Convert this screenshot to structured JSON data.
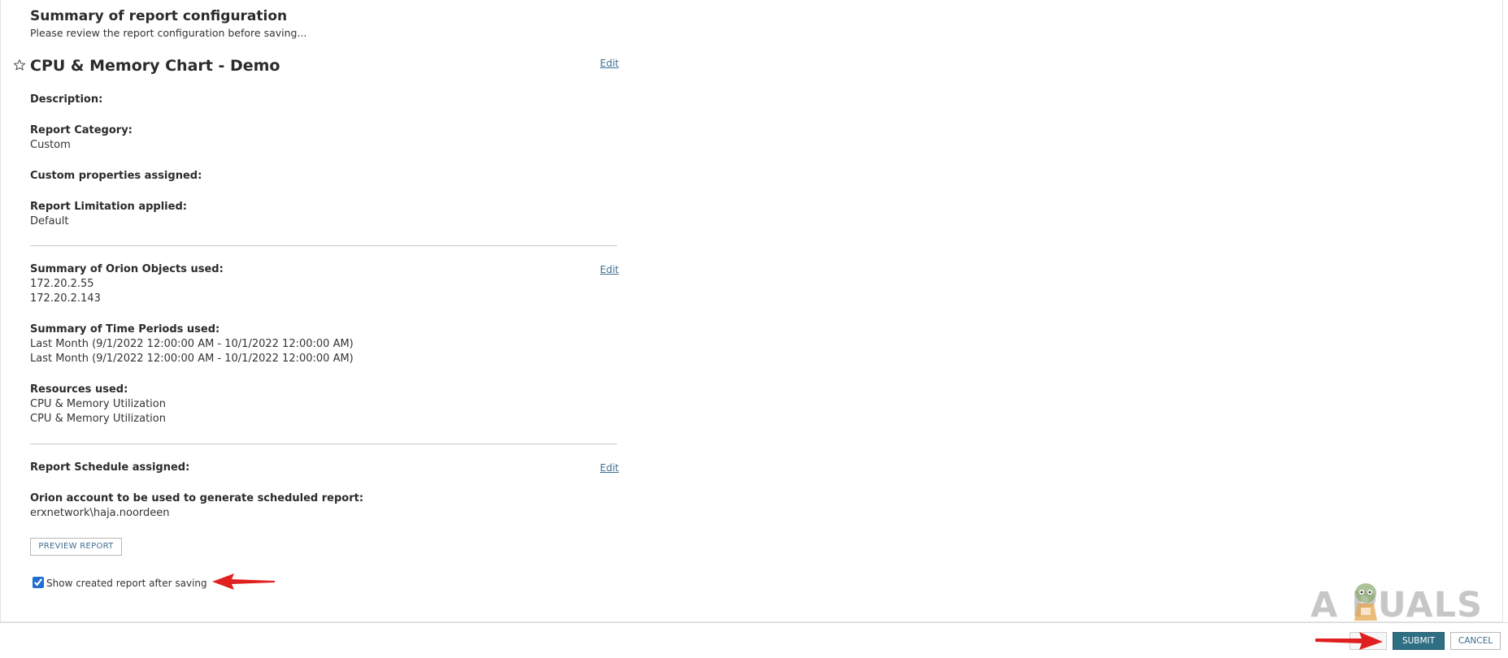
{
  "header": {
    "title": "Summary of report configuration",
    "subtitle": "Please review the report configuration before saving..."
  },
  "report": {
    "name": "CPU & Memory Chart - Demo",
    "edit_label": "Edit",
    "favorite_icon": "star-outline-icon"
  },
  "details": {
    "description_label": "Description:",
    "category_label": "Report Category:",
    "category_value": "Custom",
    "custom_props_label": "Custom properties assigned:",
    "limitation_label": "Report Limitation applied:",
    "limitation_value": "Default"
  },
  "objects": {
    "label": "Summary of Orion Objects used:",
    "edit_label": "Edit",
    "items": [
      "172.20.2.55",
      "172.20.2.143"
    ]
  },
  "time_periods": {
    "label": "Summary of Time Periods used:",
    "items": [
      "Last Month (9/1/2022 12:00:00 AM - 10/1/2022 12:00:00 AM)",
      "Last Month (9/1/2022 12:00:00 AM - 10/1/2022 12:00:00 AM)"
    ]
  },
  "resources": {
    "label": "Resources used:",
    "items": [
      "CPU & Memory Utilization",
      "CPU & Memory Utilization"
    ]
  },
  "schedule": {
    "label": "Report Schedule assigned:",
    "edit_label": "Edit",
    "account_label": "Orion account to be used to generate scheduled report:",
    "account_value": "erxnetwork\\haja.noordeen"
  },
  "actions": {
    "preview_label": "PREVIEW REPORT",
    "show_after_save_label": "Show created report after saving",
    "show_after_save_checked": true,
    "submit_label": "SUBMIT",
    "cancel_label": "CANCEL"
  },
  "colors": {
    "link": "#3e6f93",
    "submit_bg": "#2f6f83",
    "annotation_arrow": "#e02020"
  },
  "watermark": {
    "text": "A  PUALS"
  }
}
